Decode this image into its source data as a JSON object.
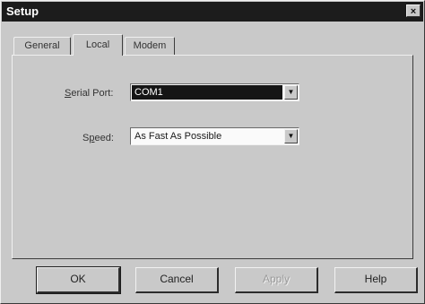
{
  "window": {
    "title": "Setup",
    "close_label": "×"
  },
  "tabs": [
    {
      "label": "General",
      "active": false
    },
    {
      "label": "Local",
      "active": true
    },
    {
      "label": "Modem",
      "active": false
    }
  ],
  "fields": {
    "serial_port": {
      "label_prefix": "",
      "label_mnemonic": "S",
      "label_suffix": "erial Port:",
      "value": "COM1"
    },
    "speed": {
      "label_prefix": "S",
      "label_mnemonic": "p",
      "label_suffix": "eed:",
      "value": "As Fast As Possible"
    }
  },
  "buttons": {
    "ok": "OK",
    "cancel": "Cancel",
    "apply": "Apply",
    "help": "Help"
  },
  "icons": {
    "dropdown": "chevron-down-icon",
    "close": "close-icon"
  }
}
